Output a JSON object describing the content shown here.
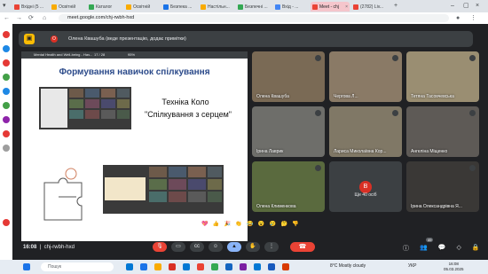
{
  "tabs": [
    {
      "label": "Вхідні (5 ...",
      "color": "#ea4335"
    },
    {
      "label": "Освітній",
      "color": "#f9ab00"
    },
    {
      "label": "Каталог",
      "color": "#34a853"
    },
    {
      "label": "Освітній",
      "color": "#f9ab00"
    },
    {
      "label": "Безпека ...",
      "color": "#1a73e8"
    },
    {
      "label": "Настільн...",
      "color": "#f9ab00"
    },
    {
      "label": "Безпечні ...",
      "color": "#34a853"
    },
    {
      "label": "Вхід - ...",
      "color": "#4285f4"
    },
    {
      "label": "Meet - chj",
      "color": "#ea4335",
      "active": true
    },
    {
      "label": "(2782) Liv...",
      "color": "#ea4335"
    }
  ],
  "address": {
    "url": "meet.google.com/chj-rwbh-hxd"
  },
  "presenting": {
    "banner": "Олена Квашуба (веде презентацію, додає примітки)",
    "avatar_letter": "О"
  },
  "slide": {
    "toolbar_title": "Mental Health and Well-being - Нач...",
    "page_counter": "17 / 28",
    "zoom": "95%",
    "title": "Формування навичок спілкування",
    "sub1": "Техніка Коло",
    "sub2": "\"Спілкування з серцем\""
  },
  "participants": [
    {
      "name": "Олена Квашуба"
    },
    {
      "name": "Чергова Л..."
    },
    {
      "name": "Тетяна Тасовчевська"
    },
    {
      "name": "Ірина Лаврик"
    },
    {
      "name": "Лариса Миколаївна Кор..."
    },
    {
      "name": "Ангеліна Міщенко"
    },
    {
      "name": "Олена Клименкова"
    },
    {
      "name": "",
      "avatar_letter": "B",
      "more": "Ще 40 осіб"
    },
    {
      "name": "Ірина Олександрівна Я..."
    }
  ],
  "meeting": {
    "time": "16:08",
    "code": "chj-rwbh-hxd",
    "participants_badge": "49"
  },
  "reactions": [
    "💖",
    "👍",
    "🎉",
    "👏",
    "😂",
    "😮",
    "😢",
    "🤔",
    "👎"
  ],
  "taskbar": {
    "search_placeholder": "Пошук",
    "weather": "8°C  Mostly cloudy",
    "lang": "УКР",
    "time": "16:08",
    "date": "05.03.2025"
  },
  "colors": {
    "meet_bg": "#202124",
    "hangup": "#ea4335",
    "present_accent": "#fbbc04",
    "slide_title": "#2b4a8a"
  }
}
